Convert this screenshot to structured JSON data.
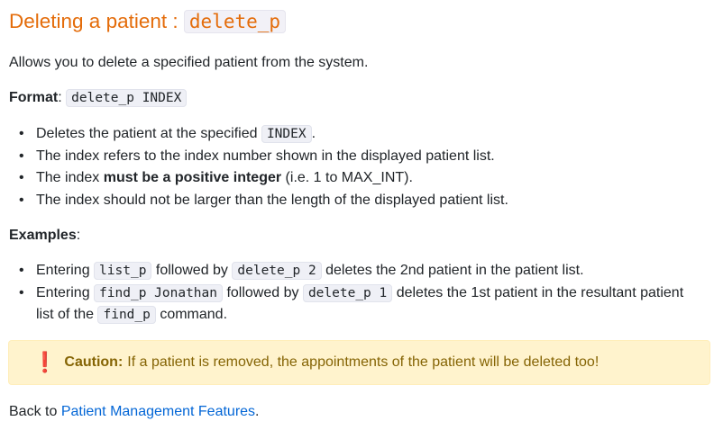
{
  "heading": {
    "text": "Deleting a patient : ",
    "command": "delete_p"
  },
  "intro": "Allows you to delete a specified patient from the system.",
  "format": {
    "label": "Format",
    "colon": ": ",
    "code": "delete_p INDEX"
  },
  "details": [
    {
      "pre": "Deletes the patient at the specified ",
      "code": "INDEX",
      "post": "."
    },
    {
      "text": "The index refers to the index number shown in the displayed patient list."
    },
    {
      "pre": "The index ",
      "bold": "must be a positive integer",
      "post": " (i.e. 1 to MAX_INT)."
    },
    {
      "text": "The index should not be larger than the length of the displayed patient list."
    }
  ],
  "examples": {
    "label": "Examples",
    "colon": ":",
    "items": [
      {
        "t1": "Entering ",
        "c1": "list_p",
        "t2": " followed by ",
        "c2": "delete_p 2",
        "t3": " deletes the 2nd patient in the patient list."
      },
      {
        "t1": "Entering ",
        "c1": "find_p Jonathan",
        "t2": " followed by ",
        "c2": "delete_p 1",
        "t3": " deletes the 1st patient in the resultant patient",
        "t4": "list of the ",
        "c3": "find_p",
        "t5": " command."
      }
    ]
  },
  "caution": {
    "icon": "exclamation-icon",
    "symbol": "❗",
    "label": "Caution:",
    "text": "If a patient is removed, the appointments of the patient will be deleted too!"
  },
  "back": {
    "prefix": "Back to ",
    "link": "Patient Management Features",
    "suffix": "."
  },
  "colors": {
    "heading": "#e46c0a",
    "link": "#0366d6",
    "caution_bg": "#fff3cd",
    "caution_text": "#856404"
  }
}
